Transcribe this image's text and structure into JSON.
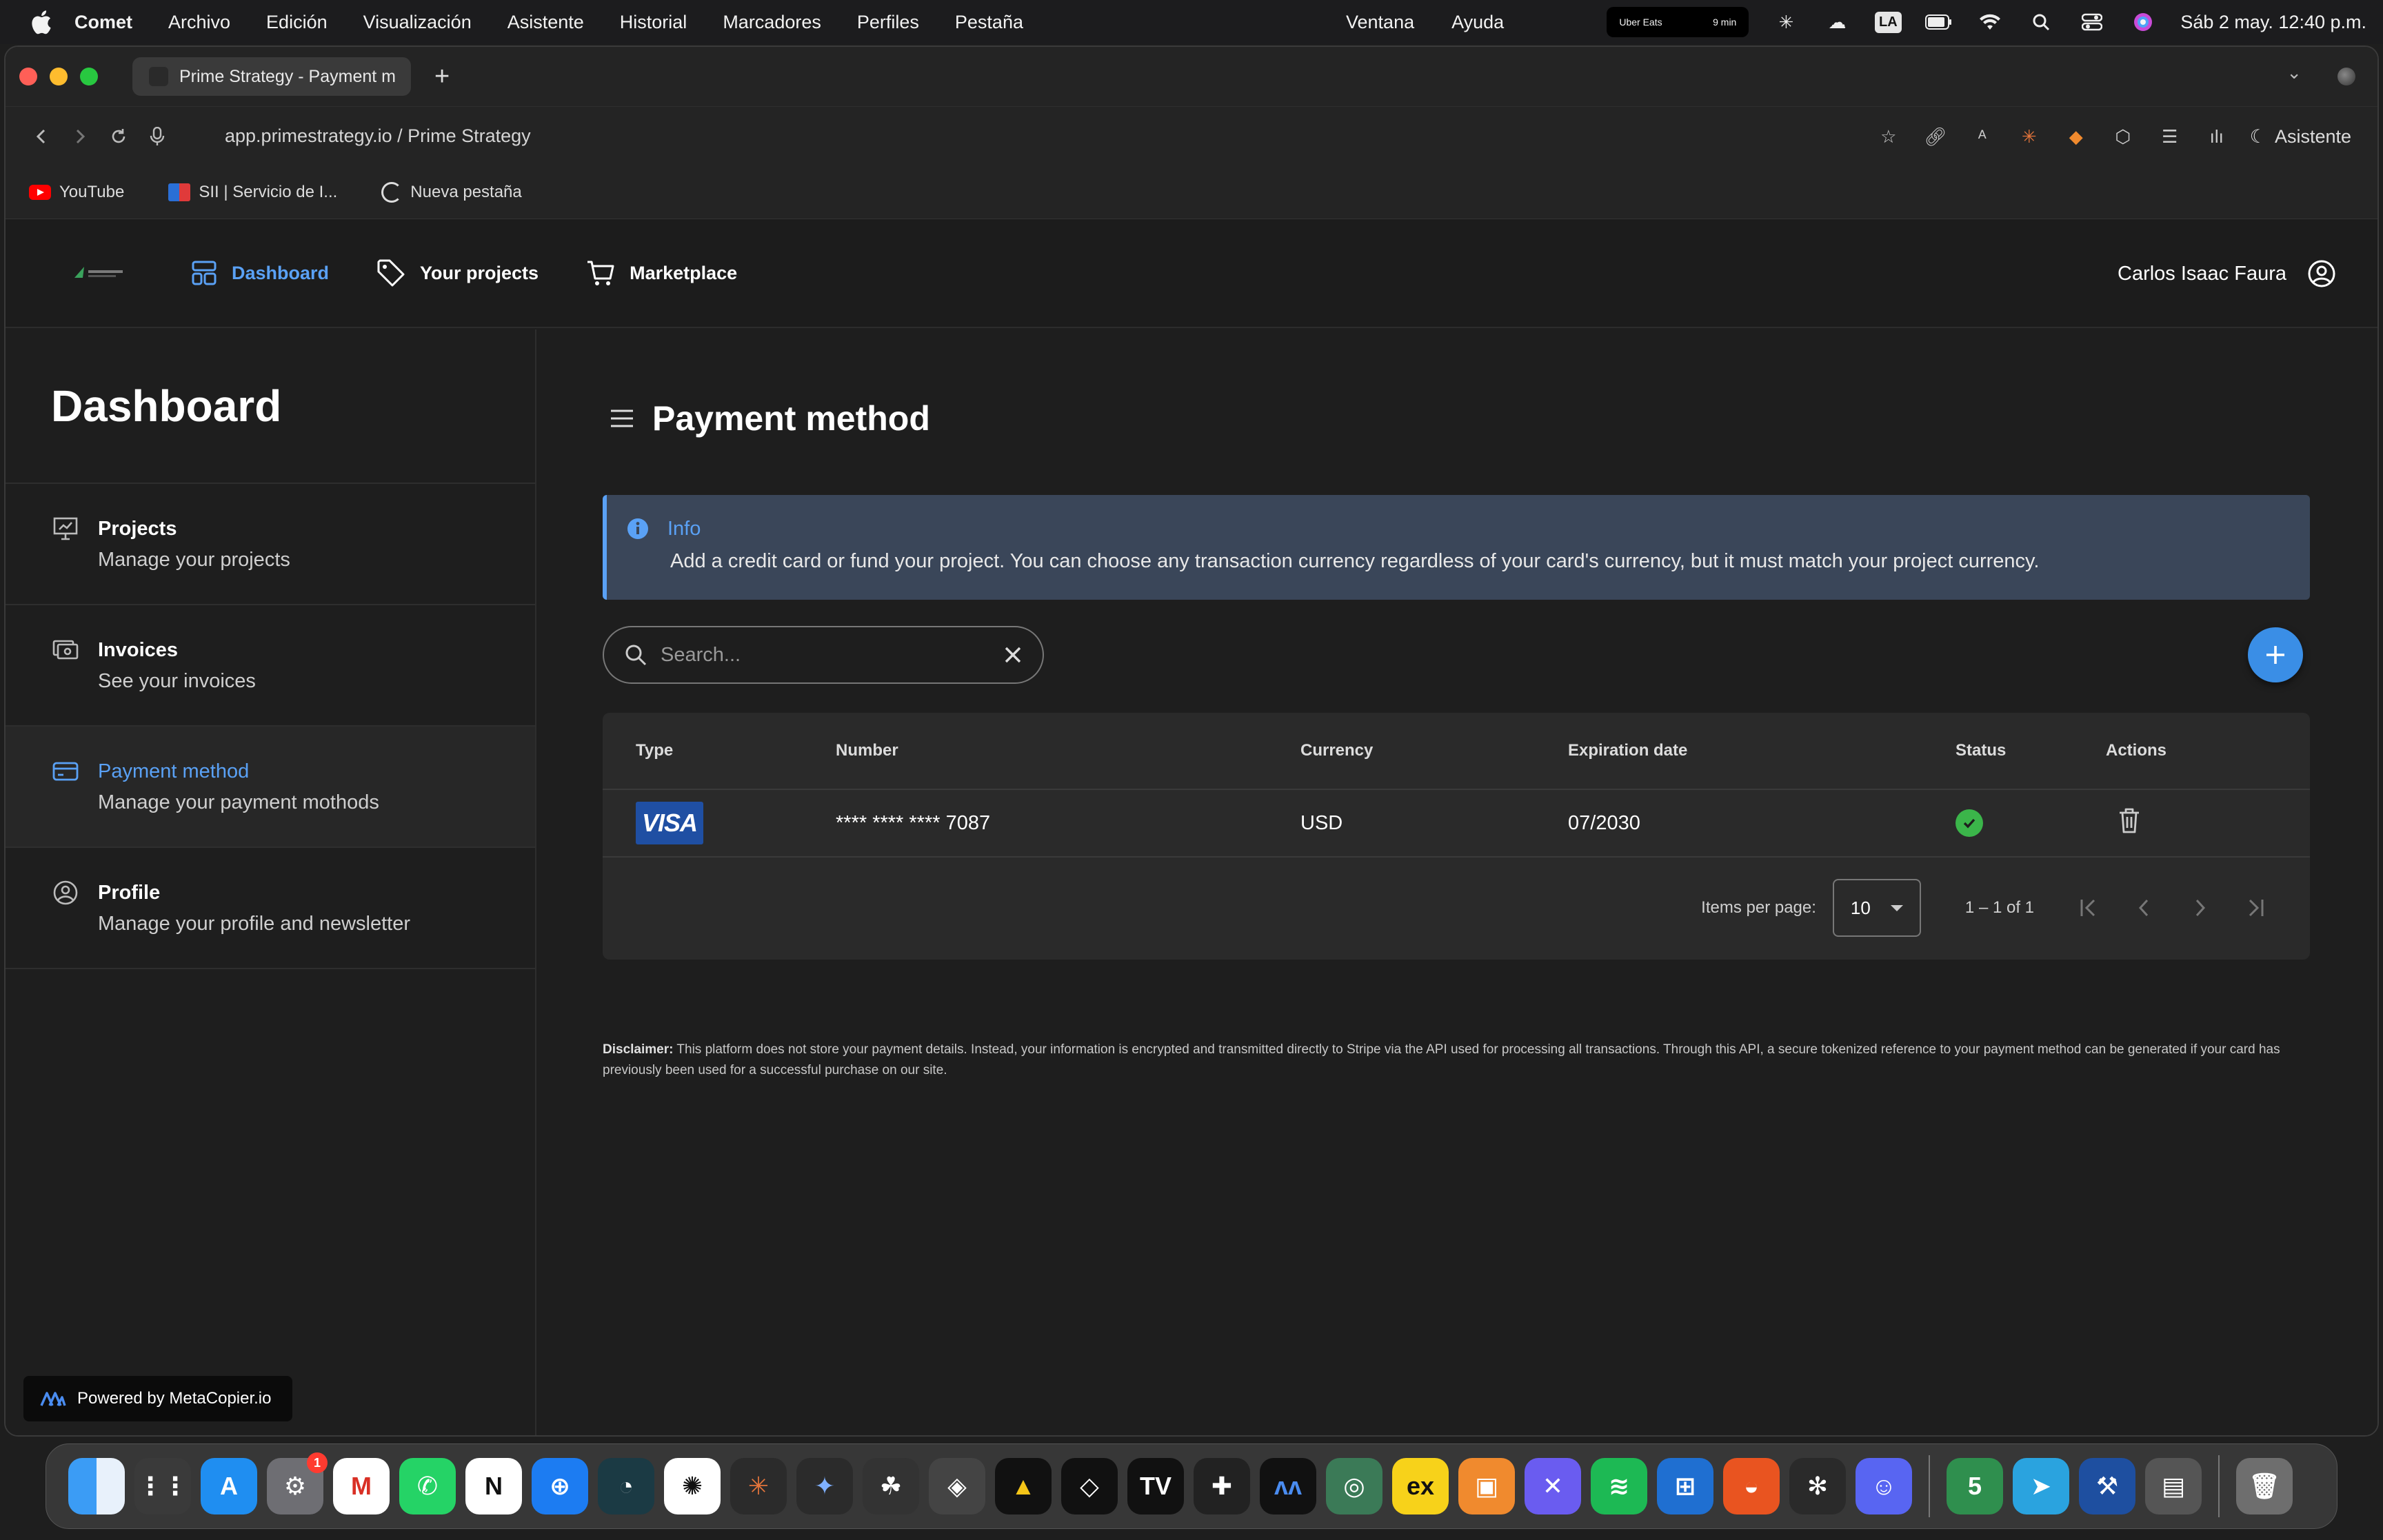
{
  "menubar": {
    "app_name": "Comet",
    "items": [
      "Archivo",
      "Edición",
      "Visualización",
      "Asistente",
      "Historial",
      "Marcadores",
      "Perfiles",
      "Pestaña"
    ],
    "right_items": [
      "Ventana",
      "Ayuda"
    ],
    "uber_label": "Uber Eats",
    "uber_value": "9 min",
    "la_label": "LA",
    "clock": "Sáb 2 may.  12:40 p.m."
  },
  "browser": {
    "tab_title": "Prime Strategy - Payment m",
    "url": "app.primestrategy.io / Prime Strategy",
    "assistant_label": "Asistente",
    "bookmarks": [
      "YouTube",
      "SII | Servicio de I...",
      "Nueva pestaña"
    ]
  },
  "header": {
    "nav": [
      {
        "label": "Dashboard",
        "icon": "dashboard-icon",
        "active": true
      },
      {
        "label": "Your projects",
        "icon": "tag-icon",
        "active": false
      },
      {
        "label": "Marketplace",
        "icon": "cart-icon",
        "active": false
      }
    ],
    "user_name": "Carlos Isaac Faura"
  },
  "sidebar": {
    "title": "Dashboard",
    "items": [
      {
        "title": "Projects",
        "subtitle": "Manage your projects",
        "icon": "presentation-icon"
      },
      {
        "title": "Invoices",
        "subtitle": "See your invoices",
        "icon": "invoices-icon"
      },
      {
        "title": "Payment method",
        "subtitle": "Manage your payment mothods",
        "icon": "card-icon",
        "active": true
      },
      {
        "title": "Profile",
        "subtitle": "Manage your profile and newsletter",
        "icon": "profile-icon"
      }
    ],
    "powered_by": "Powered by MetaCopier.io"
  },
  "main": {
    "title": "Payment method",
    "info": {
      "heading": "Info",
      "body": "Add a credit card or fund your project. You can choose any transaction currency regardless of your card's currency, but it must match your project currency."
    },
    "search_placeholder": "Search...",
    "table": {
      "columns": [
        "Type",
        "Number",
        "Currency",
        "Expiration date",
        "Status",
        "Actions"
      ],
      "rows": [
        {
          "type": "VISA",
          "number": "**** **** **** 7087",
          "currency": "USD",
          "expiration": "07/2030",
          "status": "active"
        }
      ]
    },
    "paginator": {
      "items_per_page_label": "Items per page:",
      "page_size": "10",
      "range": "1 – 1 of 1"
    },
    "disclaimer_label": "Disclaimer:",
    "disclaimer_text": "This platform does not store your payment details. Instead, your information is encrypted and transmitted directly to Stripe via the API used for processing all transactions. Through this API, a secure tokenized reference to your payment method can be generated if your card has previously been used for a successful purchase on our site."
  },
  "dock": {
    "apps": [
      "Finder",
      "Launchpad",
      "App Store",
      "System Settings",
      "Gmail",
      "WhatsApp",
      "Notion",
      "Safari",
      "Comet",
      "ChatGPT",
      "Claude",
      "Gemini",
      "App",
      "Cube",
      "Arena",
      "Cursor",
      "TradingView",
      "Capacities",
      "MetaCopier",
      "Preview",
      "Exness",
      "Box",
      "Nord",
      "Spotify",
      "Windows",
      "Ubuntu",
      "Perplexity",
      "Discord",
      "MetaTrader 5",
      "Telegram",
      "Xcode",
      "Disk",
      "Trash"
    ],
    "settings_badge": "1"
  }
}
